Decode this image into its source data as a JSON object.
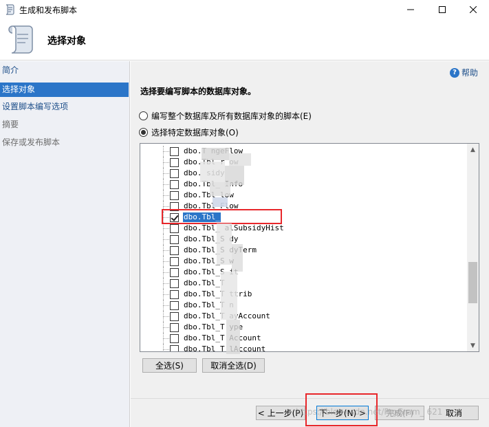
{
  "window": {
    "title": "生成和发布脚本",
    "icon": "script-scroll-icon"
  },
  "header": {
    "heading": "选择对象",
    "icon": "script-scroll-icon"
  },
  "sidebar": {
    "items": [
      {
        "label": "简介",
        "state": "link"
      },
      {
        "label": "选择对象",
        "state": "active"
      },
      {
        "label": "设置脚本编写选项",
        "state": "link"
      },
      {
        "label": "摘要",
        "state": "disabled"
      },
      {
        "label": "保存或发布脚本",
        "state": "disabled"
      }
    ]
  },
  "main": {
    "help_label": "帮助",
    "section_title": "选择要编写脚本的数据库对象。",
    "radio_all": "编写整个数据库及所有数据库对象的脚本(E)",
    "radio_specific": "选择特定数据库对象(O)",
    "radio_selected": "specific",
    "tree_items": [
      {
        "label": "dbo.T         ngeFlow",
        "checked": false
      },
      {
        "label": "dbo.Tbl  r      ow",
        "checked": false
      },
      {
        "label": "dbo.         sidy",
        "checked": false
      },
      {
        "label": "dbo.Tbl_        Info",
        "checked": false
      },
      {
        "label": "dbo.Tbl         low",
        "checked": false
      },
      {
        "label": "dbo.Tbl    Flow",
        "checked": false
      },
      {
        "label": "dbo.Tbl_",
        "checked": true,
        "selected": true
      },
      {
        "label": "dbo.Tbl_    alSubsidyHist",
        "checked": false
      },
      {
        "label": "dbo.Tbl_S   dy",
        "checked": false
      },
      {
        "label": "dbo.Tbl_S    dyTerm",
        "checked": false
      },
      {
        "label": "dbo.Tbl_S   w",
        "checked": false
      },
      {
        "label": "dbo.Tbl_S     it",
        "checked": false
      },
      {
        "label": "dbo.Tbl_T",
        "checked": false
      },
      {
        "label": "dbo.Tbl_T     ttrib",
        "checked": false
      },
      {
        "label": "dbo.Tbl_T      n",
        "checked": false
      },
      {
        "label": "dbo.Tbl_T    ayAccount",
        "checked": false
      },
      {
        "label": "dbo.Tbl_T    ype",
        "checked": false
      },
      {
        "label": "dbo.Tbl_T    Account",
        "checked": false
      },
      {
        "label": "dbo.Tbl_T    lAccount",
        "checked": false
      }
    ],
    "select_all": "全选(S)",
    "deselect_all": "取消全选(D)"
  },
  "footer": {
    "prev": "< 上一步(P)",
    "next": "下一步(N) >",
    "finish": "完成(F)",
    "cancel": "取消"
  },
  "watermark": "https://blog.csdn.net/ProGram_       621",
  "colors": {
    "accent": "#2b75c8",
    "highlight_box": "#e8262a",
    "sidebar_bg": "#eef0f5"
  }
}
